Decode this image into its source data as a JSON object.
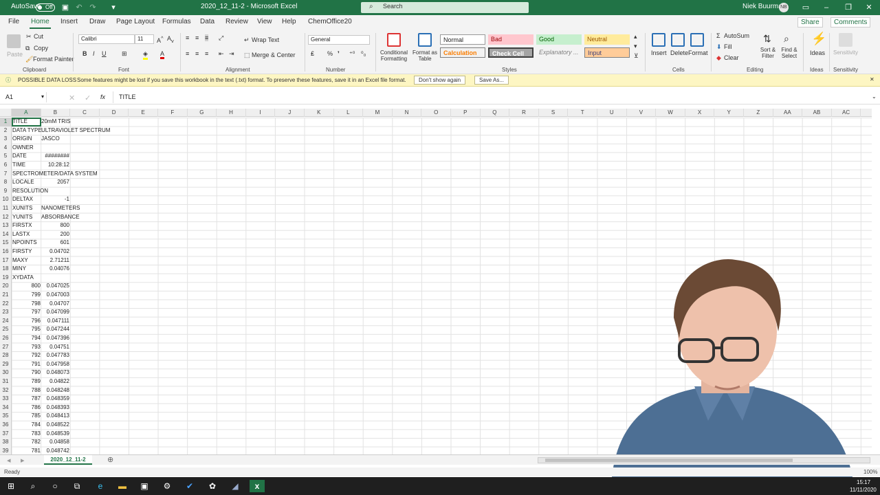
{
  "titlebar": {
    "autosave": "AutoSave",
    "toggle": "Off",
    "doc_title": "2020_12_11-2  -  Microsoft Excel",
    "search": "Search",
    "user": "Niek Buurma",
    "initials": "NB"
  },
  "menu": [
    "File",
    "Home",
    "Insert",
    "Draw",
    "Page Layout",
    "Formulas",
    "Data",
    "Review",
    "View",
    "Help",
    "ChemOffice20"
  ],
  "share": "Share",
  "comments": "Comments",
  "ribbon": {
    "clipboard": {
      "paste": "Paste",
      "cut": "Cut",
      "copy": "Copy",
      "format_painter": "Format Painter",
      "label": "Clipboard"
    },
    "font": {
      "name": "Calibri",
      "size": "11",
      "label": "Font"
    },
    "alignment": {
      "wrap": "Wrap Text",
      "merge": "Merge & Center",
      "label": "Alignment"
    },
    "number": {
      "format": "General",
      "label": "Number"
    },
    "styles": {
      "cond": "Conditional Formatting",
      "table": "Format as Table",
      "normal": "Normal",
      "bad": "Bad",
      "good": "Good",
      "neutral": "Neutral",
      "calculation": "Calculation",
      "check": "Check Cell",
      "explanatory": "Explanatory ...",
      "input": "Input",
      "label": "Styles"
    },
    "cells": {
      "insert": "Insert",
      "delete": "Delete",
      "format": "Format",
      "label": "Cells"
    },
    "editing": {
      "autosum": "AutoSum",
      "fill": "Fill",
      "clear": "Clear",
      "sort": "Sort & Filter",
      "find": "Find & Select",
      "label": "Editing"
    },
    "ideas": {
      "ideas": "Ideas",
      "label": "Ideas"
    },
    "sensitivity": {
      "label": "Sensitivity",
      "btn": "Sensitivity"
    }
  },
  "infobar": {
    "title": "POSSIBLE DATA LOSS",
    "message": "Some features might be lost if you save this workbook in the text (.txt) format. To preserve these features, save it in an Excel file format.",
    "btn1": "Don't show again",
    "btn2": "Save As..."
  },
  "formula": {
    "namebox": "A1",
    "fx": "fx",
    "content": "TITLE"
  },
  "columns": [
    "A",
    "B",
    "C",
    "D",
    "E",
    "F",
    "G",
    "H",
    "I",
    "J",
    "K",
    "L",
    "M",
    "N",
    "O",
    "P",
    "Q",
    "R",
    "S",
    "T",
    "U",
    "V",
    "W",
    "X",
    "Y",
    "Z",
    "AA",
    "AB",
    "AC"
  ],
  "rows": [
    {
      "n": "1",
      "a": "TITLE",
      "b": "20mM TRIS",
      "bn": false
    },
    {
      "n": "2",
      "a": "DATA TYPE",
      "b": "ULTRAVIOLET SPECTRUM",
      "bn": false
    },
    {
      "n": "3",
      "a": "ORIGIN",
      "b": "JASCO",
      "bn": false
    },
    {
      "n": "4",
      "a": "OWNER",
      "b": "",
      "bn": false
    },
    {
      "n": "5",
      "a": "DATE",
      "b": "########",
      "bn": true
    },
    {
      "n": "6",
      "a": "TIME",
      "b": "10:28:12",
      "bn": true
    },
    {
      "n": "7",
      "a": "SPECTROMETER/DATA SYSTEM",
      "b": "",
      "bn": false
    },
    {
      "n": "8",
      "a": "LOCALE",
      "b": "2057",
      "bn": true
    },
    {
      "n": "9",
      "a": "RESOLUTION",
      "b": "",
      "bn": false
    },
    {
      "n": "10",
      "a": "DELTAX",
      "b": "-1",
      "bn": true
    },
    {
      "n": "11",
      "a": "XUNITS",
      "b": "NANOMETERS",
      "bn": false
    },
    {
      "n": "12",
      "a": "YUNITS",
      "b": "ABSORBANCE",
      "bn": false
    },
    {
      "n": "13",
      "a": "FIRSTX",
      "b": "800",
      "bn": true
    },
    {
      "n": "14",
      "a": "LASTX",
      "b": "200",
      "bn": true
    },
    {
      "n": "15",
      "a": "NPOINTS",
      "b": "601",
      "bn": true
    },
    {
      "n": "16",
      "a": "FIRSTY",
      "b": "0.04702",
      "bn": true
    },
    {
      "n": "17",
      "a": "MAXY",
      "b": "2.71211",
      "bn": true
    },
    {
      "n": "18",
      "a": "MINY",
      "b": "0.04076",
      "bn": true
    },
    {
      "n": "19",
      "a": "XYDATA",
      "b": "",
      "bn": false
    },
    {
      "n": "20",
      "a": "800",
      "an": true,
      "b": "0.047025",
      "bn": true
    },
    {
      "n": "21",
      "a": "799",
      "an": true,
      "b": "0.047003",
      "bn": true
    },
    {
      "n": "22",
      "a": "798",
      "an": true,
      "b": "0.04707",
      "bn": true
    },
    {
      "n": "23",
      "a": "797",
      "an": true,
      "b": "0.047099",
      "bn": true
    },
    {
      "n": "24",
      "a": "796",
      "an": true,
      "b": "0.047111",
      "bn": true
    },
    {
      "n": "25",
      "a": "795",
      "an": true,
      "b": "0.047244",
      "bn": true
    },
    {
      "n": "26",
      "a": "794",
      "an": true,
      "b": "0.047396",
      "bn": true
    },
    {
      "n": "27",
      "a": "793",
      "an": true,
      "b": "0.04751",
      "bn": true
    },
    {
      "n": "28",
      "a": "792",
      "an": true,
      "b": "0.047783",
      "bn": true
    },
    {
      "n": "29",
      "a": "791",
      "an": true,
      "b": "0.047958",
      "bn": true
    },
    {
      "n": "30",
      "a": "790",
      "an": true,
      "b": "0.048073",
      "bn": true
    },
    {
      "n": "31",
      "a": "789",
      "an": true,
      "b": "0.04822",
      "bn": true
    },
    {
      "n": "32",
      "a": "788",
      "an": true,
      "b": "0.048248",
      "bn": true
    },
    {
      "n": "33",
      "a": "787",
      "an": true,
      "b": "0.048359",
      "bn": true
    },
    {
      "n": "34",
      "a": "786",
      "an": true,
      "b": "0.048393",
      "bn": true
    },
    {
      "n": "35",
      "a": "785",
      "an": true,
      "b": "0.048413",
      "bn": true
    },
    {
      "n": "36",
      "a": "784",
      "an": true,
      "b": "0.048522",
      "bn": true
    },
    {
      "n": "37",
      "a": "783",
      "an": true,
      "b": "0.048539",
      "bn": true
    },
    {
      "n": "38",
      "a": "782",
      "an": true,
      "b": "0.04858",
      "bn": true
    },
    {
      "n": "39",
      "a": "781",
      "an": true,
      "b": "0.048742",
      "bn": true
    }
  ],
  "sheet_tab": "2020_12_11-2",
  "status": {
    "ready": "Ready",
    "zoom": "100%"
  },
  "clock": {
    "time": "15:17",
    "date": "11/11/2020"
  },
  "colors": {
    "accent": "#217346",
    "info": "#fdf6c3"
  }
}
